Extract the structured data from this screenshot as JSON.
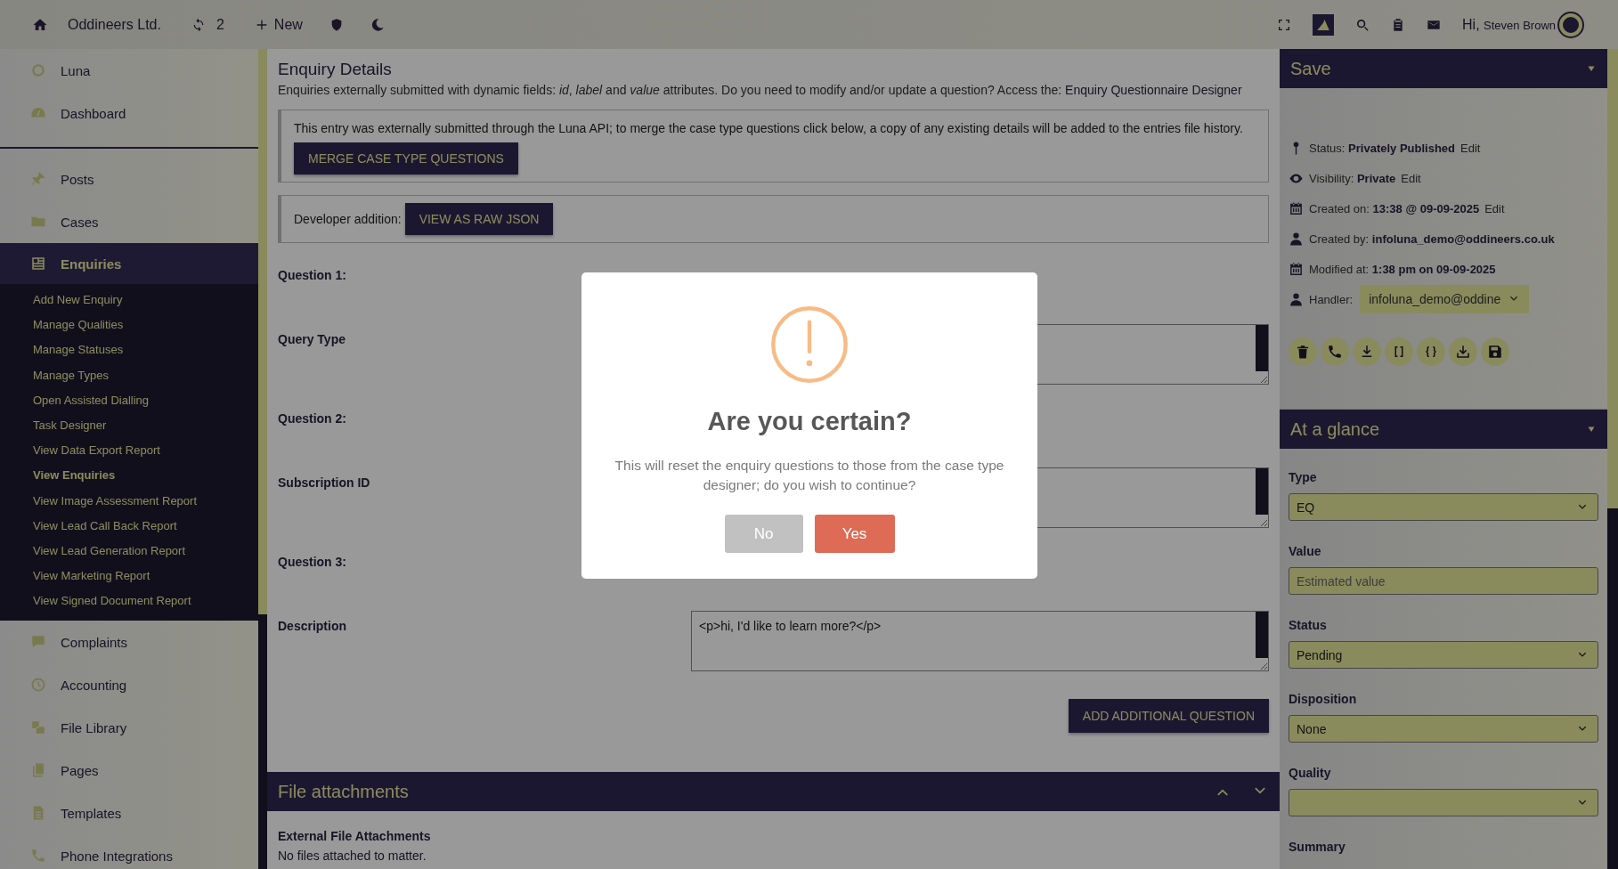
{
  "topbar": {
    "brand": "Oddineers Ltd.",
    "sync_count": "2",
    "new_label": "New",
    "greeting": "Hi,",
    "user": "Steven Brown"
  },
  "sidebar": {
    "sections": [
      {
        "items": [
          {
            "label": "Luna",
            "selected": false
          },
          {
            "label": "Dashboard",
            "selected": false
          }
        ]
      },
      {
        "items": [
          {
            "label": "Posts",
            "selected": false
          },
          {
            "label": "Cases",
            "selected": false
          },
          {
            "label": "Enquiries",
            "selected": true,
            "children": [
              {
                "label": "Add New Enquiry",
                "selected": false
              },
              {
                "label": "Manage Qualities",
                "selected": false
              },
              {
                "label": "Manage Statuses",
                "selected": false
              },
              {
                "label": "Manage Types",
                "selected": false
              },
              {
                "label": "Open Assisted Dialling",
                "selected": false
              },
              {
                "label": "Task Designer",
                "selected": false
              },
              {
                "label": "View Data Export Report",
                "selected": false
              },
              {
                "label": "View Enquiries",
                "selected": true
              },
              {
                "label": "View Image Assessment Report",
                "selected": false
              },
              {
                "label": "View Lead Call Back Report",
                "selected": false
              },
              {
                "label": "View Lead Generation Report",
                "selected": false
              },
              {
                "label": "View Marketing Report",
                "selected": false
              },
              {
                "label": "View Signed Document Report",
                "selected": false
              }
            ]
          },
          {
            "label": "Complaints",
            "selected": false
          },
          {
            "label": "Accounting",
            "selected": false
          },
          {
            "label": "File Library",
            "selected": false
          },
          {
            "label": "Pages",
            "selected": false
          },
          {
            "label": "Templates",
            "selected": false
          },
          {
            "label": "Phone Integrations",
            "selected": false
          }
        ]
      }
    ]
  },
  "main": {
    "title": "Enquiry Details",
    "intro": "Enquiries externally submitted with dynamic fields: *id*, *label* and *value* attributes. Do you need to modify and/or update a question? Access the:",
    "designer_link": "Enquiry Questionnaire Designer",
    "notice": {
      "text": "This entry was externally submitted through the Luna API; to merge the case type questions click below, a copy of any existing details will be added to the entries file history.",
      "button": "MERGE CASE TYPE QUESTIONS"
    },
    "developer": {
      "label": "Developer addition:",
      "button": "VIEW AS RAW JSON"
    },
    "questions": [
      {
        "kind": "heading",
        "label": "Question 1:"
      },
      {
        "kind": "field",
        "label": "Query Type"
      },
      {
        "kind": "heading",
        "label": "Question 2:"
      },
      {
        "kind": "field",
        "label": "Subscription ID"
      },
      {
        "kind": "heading",
        "label": "Question 3:"
      },
      {
        "kind": "field",
        "label": "Description",
        "value": "<p>hi, I'd like to learn more?</p>"
      }
    ],
    "add_button": "ADD ADDITIONAL QUESTION",
    "attachments": {
      "title": "File attachments",
      "heading": "External File Attachments",
      "text": "No files attached to matter."
    }
  },
  "save_panel": {
    "title": "Save",
    "meta": [
      {
        "label": "Status:",
        "value": "Privately Published",
        "edit": "Edit"
      },
      {
        "label": "Visibility:",
        "value": "Private",
        "edit": "Edit"
      },
      {
        "label": "Created on:",
        "value": "13:38 @ 09-09-2025",
        "edit": "Edit"
      },
      {
        "label": "Created by:",
        "value": "infoluna_demo@oddineers.co.uk"
      },
      {
        "label": "Modified at:",
        "value": "1:38 pm on 09-09-2025"
      }
    ],
    "handler": {
      "label": "Handler:",
      "value": "infoluna_demo@oddine"
    }
  },
  "glance": {
    "title": "At a glance",
    "fields": [
      {
        "label": "Type",
        "kind": "select",
        "value": "EQ"
      },
      {
        "label": "Value",
        "kind": "input",
        "placeholder": "Estimated value"
      },
      {
        "label": "Status",
        "kind": "select",
        "value": "Pending"
      },
      {
        "label": "Disposition",
        "kind": "select",
        "value": "None"
      },
      {
        "label": "Quality",
        "kind": "select"
      },
      {
        "label": "Summary",
        "kind": "label"
      }
    ]
  },
  "modal": {
    "title": "Are you certain?",
    "message": "This will reset the enquiry questions to those from the case type designer; do you wish to continue?",
    "buttons": [
      {
        "label": "No",
        "kind": "cancel"
      },
      {
        "label": "Yes",
        "kind": "confirm"
      }
    ]
  }
}
